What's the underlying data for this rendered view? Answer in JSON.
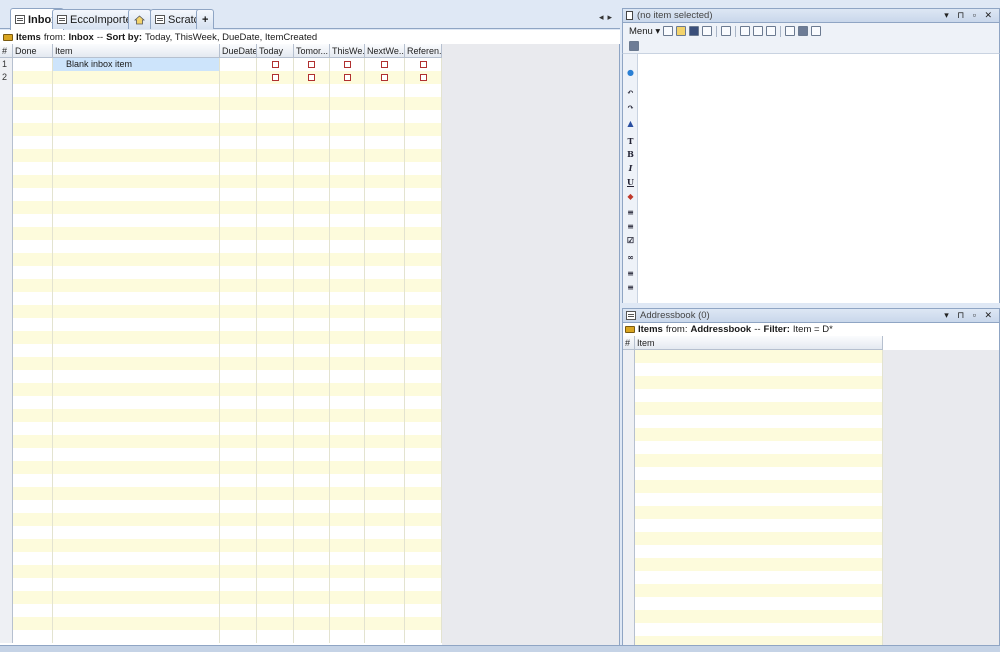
{
  "left_pane": {
    "tabs": [
      {
        "label": "Inbox",
        "active": true
      },
      {
        "label": "EccoImported *",
        "active": false
      },
      {
        "label": "",
        "icon": "home-icon",
        "active": false
      },
      {
        "label": "Scratch",
        "active": false
      },
      {
        "label": "+",
        "active": false
      }
    ],
    "header": {
      "items_label": "Items",
      "from_text": "from:",
      "source": "Inbox",
      "sep": "--",
      "sort_label": "Sort by:",
      "sort_value": "Today, ThisWeek, DueDate, ItemCreated"
    },
    "grid": {
      "columns": [
        "#",
        "Done",
        "Item",
        "DueDate",
        "Today",
        "Tomor...",
        "ThisWe...",
        "NextWe...",
        "Referen..."
      ],
      "rows": [
        {
          "num": "1",
          "item": "Blank inbox item"
        },
        {
          "num": "2",
          "item": ""
        }
      ]
    }
  },
  "notes_pane": {
    "title": "(no item selected)",
    "menu_label": "Menu"
  },
  "addressbook_pane": {
    "title": "Addressbook (0)",
    "header": {
      "items_label": "Items",
      "from_text": "from:",
      "source": "Addressbook",
      "sep": "--",
      "filter_label": "Filter:",
      "filter_value": "Item = D*"
    },
    "grid": {
      "columns": [
        "#",
        "Item"
      ]
    }
  },
  "colors": {
    "row_stripe": "#fdfbdc",
    "selection": "#cde4fb",
    "chrome": "#dfe8f5"
  }
}
